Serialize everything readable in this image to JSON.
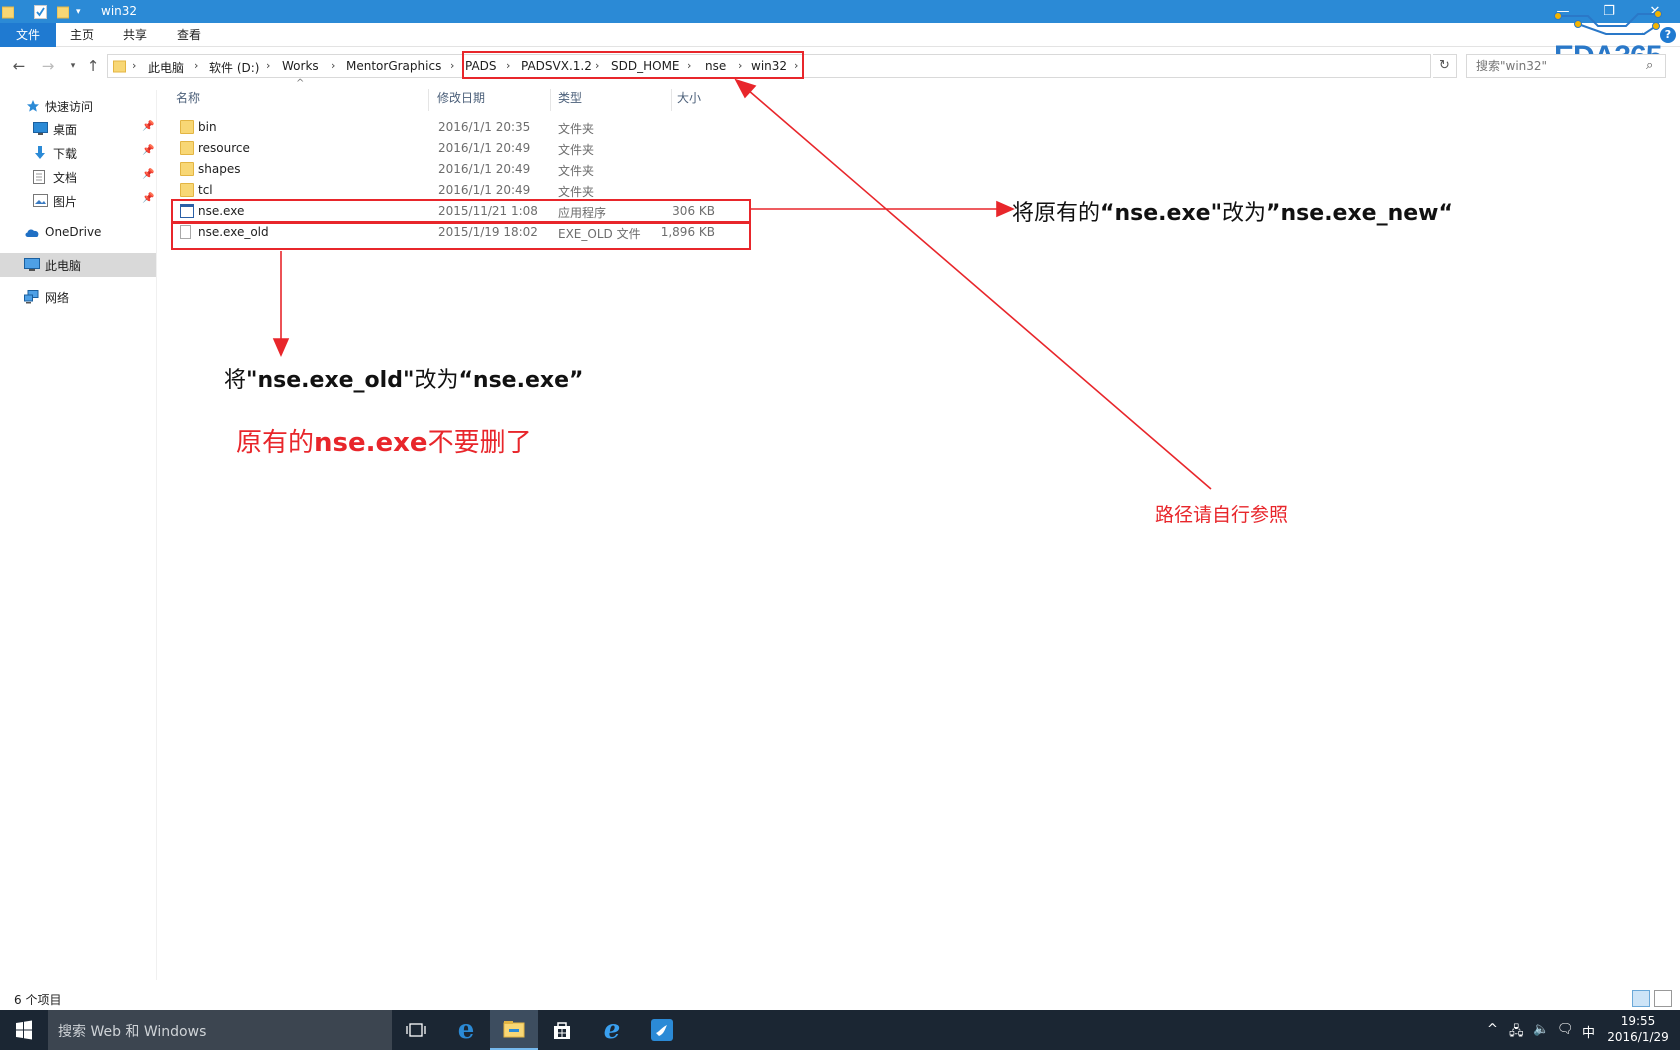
{
  "window": {
    "title": "win32"
  },
  "ribbon": {
    "tabs": [
      "文件",
      "主页",
      "共享",
      "查看"
    ]
  },
  "logo": {
    "text": "EDA365",
    "color": "#2a78c8"
  },
  "address": {
    "crumbs": [
      "此电脑",
      "软件 (D:)",
      "Works",
      "MentorGraphics",
      "PADS",
      "PADSVX.1.2",
      "SDD_HOME",
      "nse",
      "win32"
    ]
  },
  "search": {
    "placeholder": "搜索\"win32\""
  },
  "sidebar": {
    "quick_access": "快速访问",
    "items": [
      "桌面",
      "下载",
      "文档",
      "图片"
    ],
    "onedrive": "OneDrive",
    "this_pc": "此电脑",
    "network": "网络"
  },
  "columns": {
    "name": "名称",
    "date": "修改日期",
    "type": "类型",
    "size": "大小"
  },
  "files": [
    {
      "name": "bin",
      "date": "2016/1/1 20:35",
      "type": "文件夹",
      "size": "",
      "icon": "folder-icon"
    },
    {
      "name": "resource",
      "date": "2016/1/1 20:49",
      "type": "文件夹",
      "size": "",
      "icon": "folder-icon"
    },
    {
      "name": "shapes",
      "date": "2016/1/1 20:49",
      "type": "文件夹",
      "size": "",
      "icon": "folder-icon"
    },
    {
      "name": "tcl",
      "date": "2016/1/1 20:49",
      "type": "文件夹",
      "size": "",
      "icon": "folder-icon"
    },
    {
      "name": "nse.exe",
      "date": "2015/11/21 1:08",
      "type": "应用程序",
      "size": "306 KB",
      "icon": "exe-icon"
    },
    {
      "name": "nse.exe_old",
      "date": "2015/1/19 18:02",
      "type": "EXE_OLD 文件",
      "size": "1,896 KB",
      "icon": "file-icon"
    }
  ],
  "annotations": {
    "rename_exe": {
      "prefix": "将原有的",
      "q1": "“",
      "bold1": "nse.exe",
      "q2": "\"",
      "mid": "改为",
      "q3": "”",
      "bold2": "nse.exe_new",
      "q4": "“"
    },
    "rename_old": {
      "prefix": "将",
      "q1": "\"",
      "bold1": "nse.exe_old",
      "q2": "\"",
      "mid": "改为",
      "q3": "“",
      "bold2": "nse.exe",
      "q4": "”"
    },
    "keep_note": {
      "prefix": "原有的",
      "bold": "nse.exe",
      "suffix": "不要删了"
    },
    "path_note": "路径请自行参照",
    "color": "#e8262b"
  },
  "status": {
    "count": "6 个项目"
  },
  "taskbar": {
    "search_placeholder": "搜索 Web 和 Windows",
    "ime": "中",
    "time": "19:55",
    "date": "2016/1/29"
  }
}
